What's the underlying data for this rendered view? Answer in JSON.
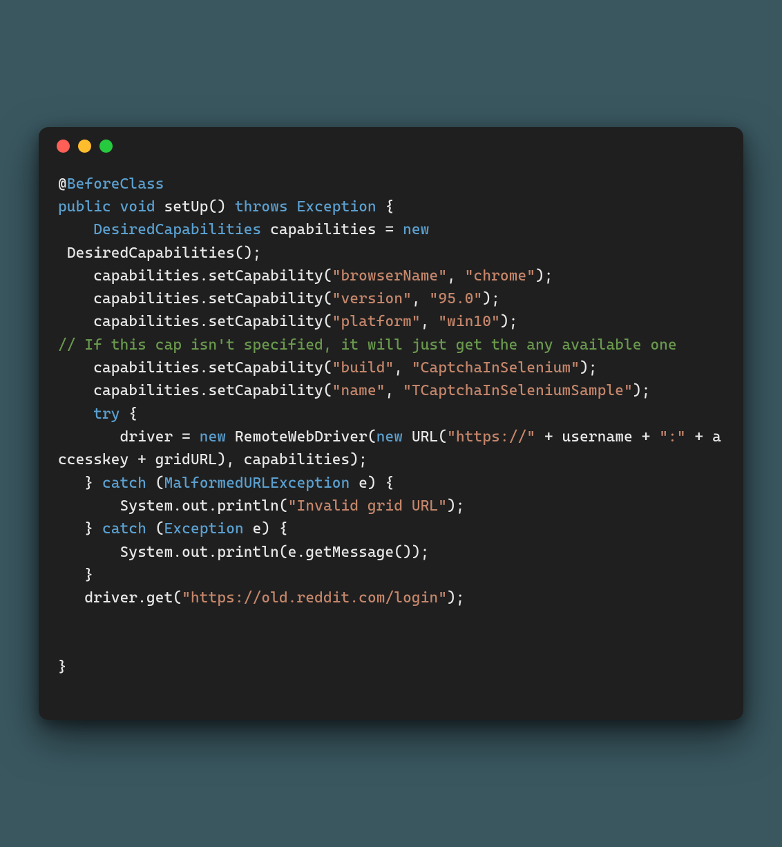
{
  "window": {
    "traffic_lights": [
      "red",
      "yellow",
      "green"
    ]
  },
  "code": {
    "tokens": [
      {
        "cls": "t-plain",
        "txt": "@"
      },
      {
        "cls": "t-annotation",
        "txt": "BeforeClass"
      },
      {
        "cls": "t-plain",
        "txt": "\n"
      },
      {
        "cls": "t-keyword",
        "txt": "public"
      },
      {
        "cls": "t-plain",
        "txt": " "
      },
      {
        "cls": "t-keyword",
        "txt": "void"
      },
      {
        "cls": "t-plain",
        "txt": " setUp() "
      },
      {
        "cls": "t-keyword",
        "txt": "throws"
      },
      {
        "cls": "t-plain",
        "txt": " "
      },
      {
        "cls": "t-type",
        "txt": "Exception"
      },
      {
        "cls": "t-plain",
        "txt": " {\n    "
      },
      {
        "cls": "t-type",
        "txt": "DesiredCapabilities"
      },
      {
        "cls": "t-plain",
        "txt": " capabilities = "
      },
      {
        "cls": "t-keyword",
        "txt": "new"
      },
      {
        "cls": "t-plain",
        "txt": "\n DesiredCapabilities();\n    capabilities.setCapability("
      },
      {
        "cls": "t-string",
        "txt": "\"browserName\""
      },
      {
        "cls": "t-plain",
        "txt": ", "
      },
      {
        "cls": "t-string",
        "txt": "\"chrome\""
      },
      {
        "cls": "t-plain",
        "txt": ");\n    capabilities.setCapability("
      },
      {
        "cls": "t-string",
        "txt": "\"version\""
      },
      {
        "cls": "t-plain",
        "txt": ", "
      },
      {
        "cls": "t-string",
        "txt": "\"95.0\""
      },
      {
        "cls": "t-plain",
        "txt": ");\n    capabilities.setCapability("
      },
      {
        "cls": "t-string",
        "txt": "\"platform\""
      },
      {
        "cls": "t-plain",
        "txt": ", "
      },
      {
        "cls": "t-string",
        "txt": "\"win10\""
      },
      {
        "cls": "t-plain",
        "txt": ");\n"
      },
      {
        "cls": "t-comment",
        "txt": "// If this cap isn't specified, it will just get the any available one"
      },
      {
        "cls": "t-plain",
        "txt": "\n    capabilities.setCapability("
      },
      {
        "cls": "t-string",
        "txt": "\"build\""
      },
      {
        "cls": "t-plain",
        "txt": ", "
      },
      {
        "cls": "t-string",
        "txt": "\"CaptchaInSelenium\""
      },
      {
        "cls": "t-plain",
        "txt": ");\n    capabilities.setCapability("
      },
      {
        "cls": "t-string",
        "txt": "\"name\""
      },
      {
        "cls": "t-plain",
        "txt": ", "
      },
      {
        "cls": "t-string",
        "txt": "\"TCaptchaInSeleniumSample\""
      },
      {
        "cls": "t-plain",
        "txt": ");\n    "
      },
      {
        "cls": "t-keyword",
        "txt": "try"
      },
      {
        "cls": "t-plain",
        "txt": " {\n       driver = "
      },
      {
        "cls": "t-keyword",
        "txt": "new"
      },
      {
        "cls": "t-plain",
        "txt": " RemoteWebDriver("
      },
      {
        "cls": "t-keyword",
        "txt": "new"
      },
      {
        "cls": "t-plain",
        "txt": " URL("
      },
      {
        "cls": "t-string",
        "txt": "\"https://\""
      },
      {
        "cls": "t-plain",
        "txt": " + username + "
      },
      {
        "cls": "t-string",
        "txt": "\":\""
      },
      {
        "cls": "t-plain",
        "txt": " + accesskey + gridURL), capabilities);\n   } "
      },
      {
        "cls": "t-keyword",
        "txt": "catch"
      },
      {
        "cls": "t-plain",
        "txt": " ("
      },
      {
        "cls": "t-type",
        "txt": "MalformedURLException"
      },
      {
        "cls": "t-plain",
        "txt": " e) {\n       System.out.println("
      },
      {
        "cls": "t-string",
        "txt": "\"Invalid grid URL\""
      },
      {
        "cls": "t-plain",
        "txt": ");\n   } "
      },
      {
        "cls": "t-keyword",
        "txt": "catch"
      },
      {
        "cls": "t-plain",
        "txt": " ("
      },
      {
        "cls": "t-type",
        "txt": "Exception"
      },
      {
        "cls": "t-plain",
        "txt": " e) {\n       System.out.println(e.getMessage());\n   }\n   driver.get("
      },
      {
        "cls": "t-string",
        "txt": "\"https://old.reddit.com/login\""
      },
      {
        "cls": "t-plain",
        "txt": ");\n\n\n}"
      }
    ]
  }
}
